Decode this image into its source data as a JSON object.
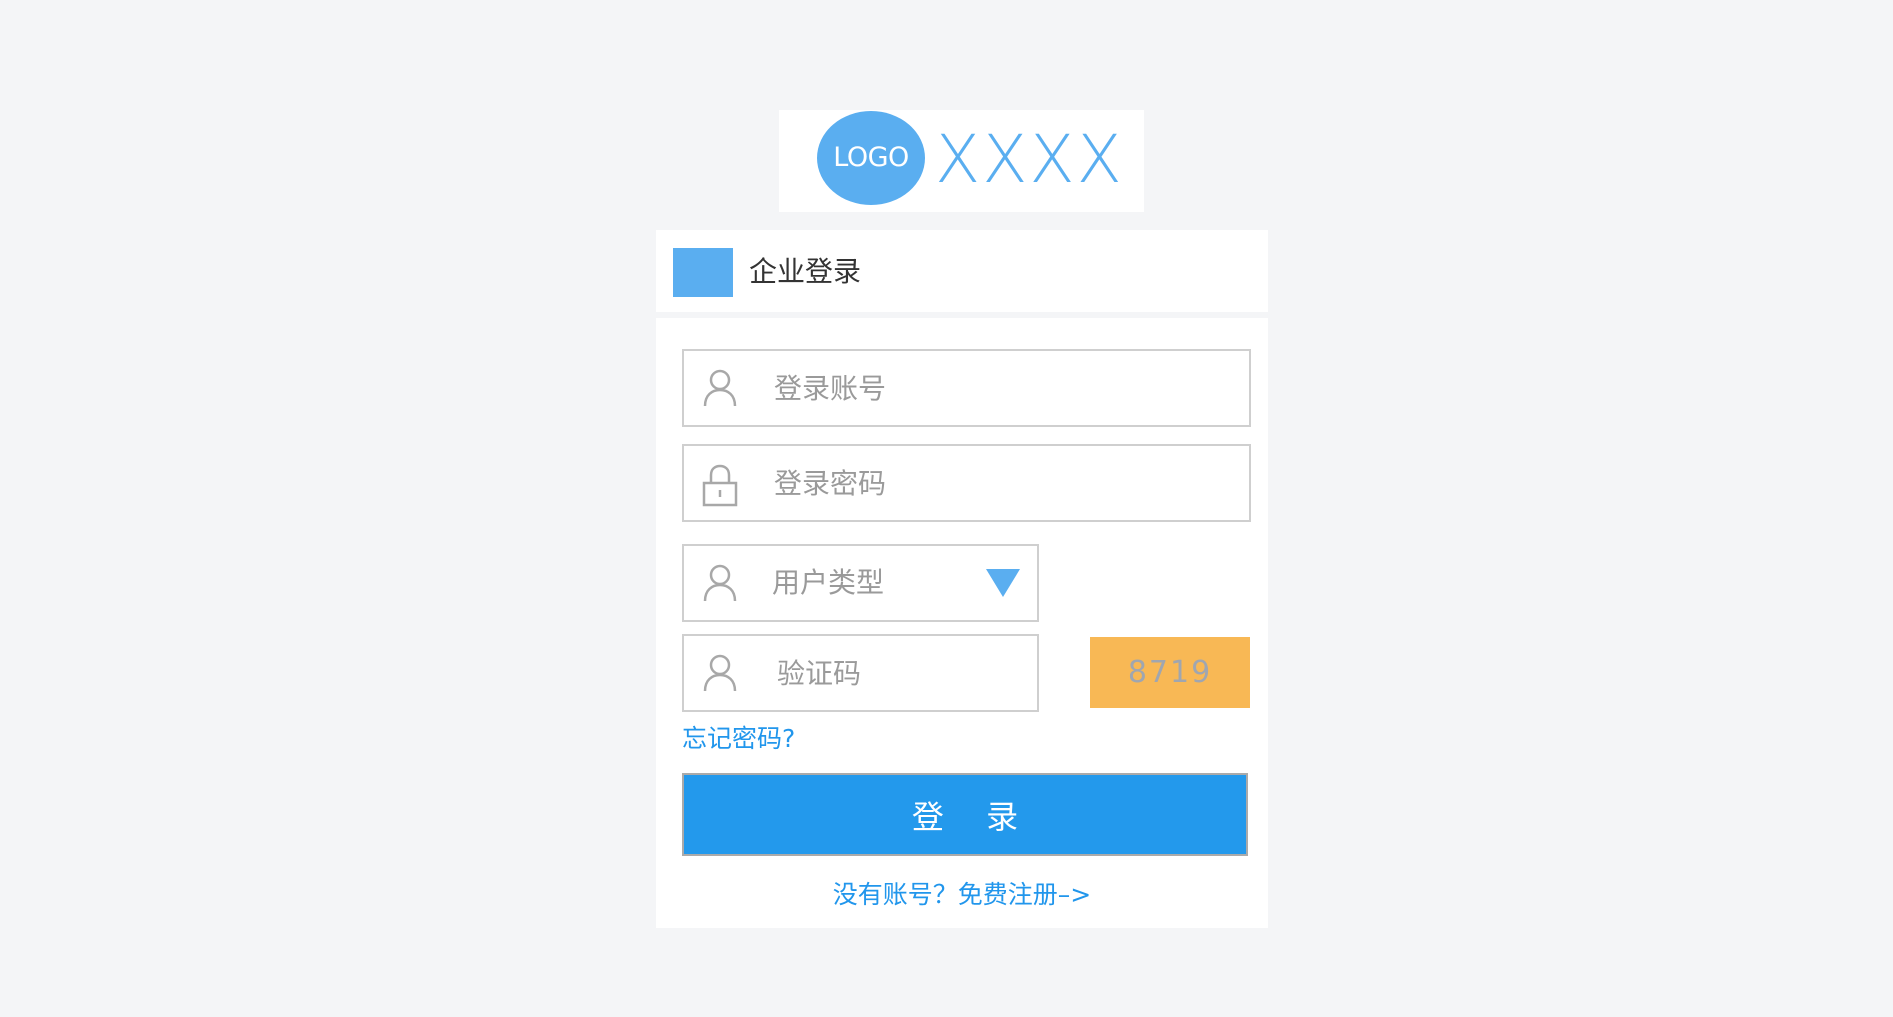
{
  "logo": {
    "badge_text": "LOGO",
    "brand_text": "XXXX"
  },
  "header": {
    "title": "企业登录"
  },
  "form": {
    "account_placeholder": "登录账号",
    "password_placeholder": "登录密码",
    "user_type_label": "用户类型",
    "captcha_placeholder": "验证码",
    "captcha_code": "8719",
    "forgot_password": "忘记密码?",
    "login_button": "登 录",
    "register_link": "没有账号？免费注册–>"
  },
  "icons": {
    "account": "user-icon",
    "password": "lock-icon",
    "user_type": "user-icon",
    "captcha": "user-icon",
    "dropdown": "triangle-down-icon"
  },
  "colors": {
    "background": "#f4f5f7",
    "accent": "#5aaef0",
    "primary_button": "#2399ec",
    "link": "#2196ec",
    "captcha_bg": "#f8b855"
  }
}
